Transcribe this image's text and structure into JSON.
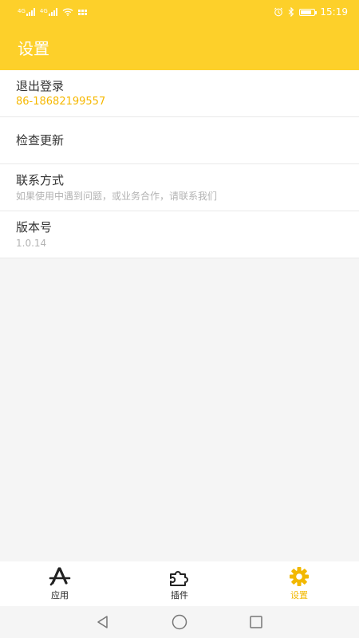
{
  "status_bar": {
    "signal1_tag": "4G",
    "signal2_tag": "4G",
    "time": "15:19",
    "battery_level": 0.8,
    "icons": [
      "signal-icon",
      "signal-icon",
      "wifi-icon",
      "app-grid-icon",
      "alarm-icon",
      "bluetooth-icon",
      "battery-icon"
    ]
  },
  "header": {
    "title": "设置"
  },
  "settings": {
    "logout": {
      "title": "退出登录",
      "value": "86-18682199557"
    },
    "update": {
      "title": "检查更新"
    },
    "contact": {
      "title": "联系方式",
      "value": "如果使用中遇到问题，或业务合作，请联系我们"
    },
    "version": {
      "title": "版本号",
      "value": "1.0.14"
    }
  },
  "tabs": [
    {
      "label": "应用",
      "icon": "app-store-icon",
      "active": false
    },
    {
      "label": "插件",
      "icon": "puzzle-icon",
      "active": false
    },
    {
      "label": "设置",
      "icon": "gear-icon",
      "active": true
    }
  ],
  "colors": {
    "accent": "#fdd02a",
    "active_tab": "#f2b800",
    "phone_text": "#f6b800"
  },
  "nav_bar": {
    "icons": [
      "back-icon",
      "home-icon",
      "recents-icon"
    ]
  }
}
